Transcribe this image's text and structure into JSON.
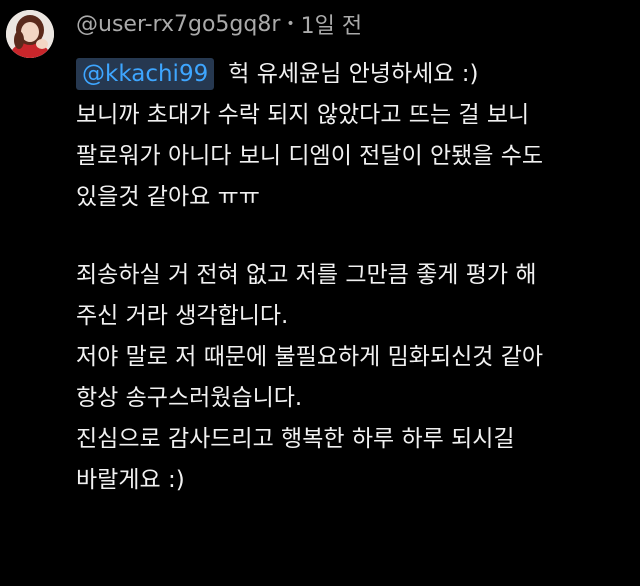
{
  "comment": {
    "author": "@user-rx7go5gq8r",
    "separator": "•",
    "timestamp": "1일 전",
    "mention": "@kkachi99",
    "first_line_rest": "헉 유세윤님 안녕하세요 :)",
    "lines": [
      "보니까 초대가 수락 되지 않았다고 뜨는 걸 보니",
      "팔로워가 아니다 보니 디엠이 전달이 안됐을 수도",
      "있을것 같아요 ㅠㅠ",
      "",
      "죄송하실 거 전혀 없고 저를 그만큼 좋게 평가 해",
      "주신 거라 생각합니다.",
      "저야 말로 저 때문에 불필요하게 밈화되신것 같아",
      "항상 송구스러웠습니다.",
      "진심으로 감사드리고 행복한 하루 하루 되시길",
      "바랄게요 :)"
    ]
  }
}
